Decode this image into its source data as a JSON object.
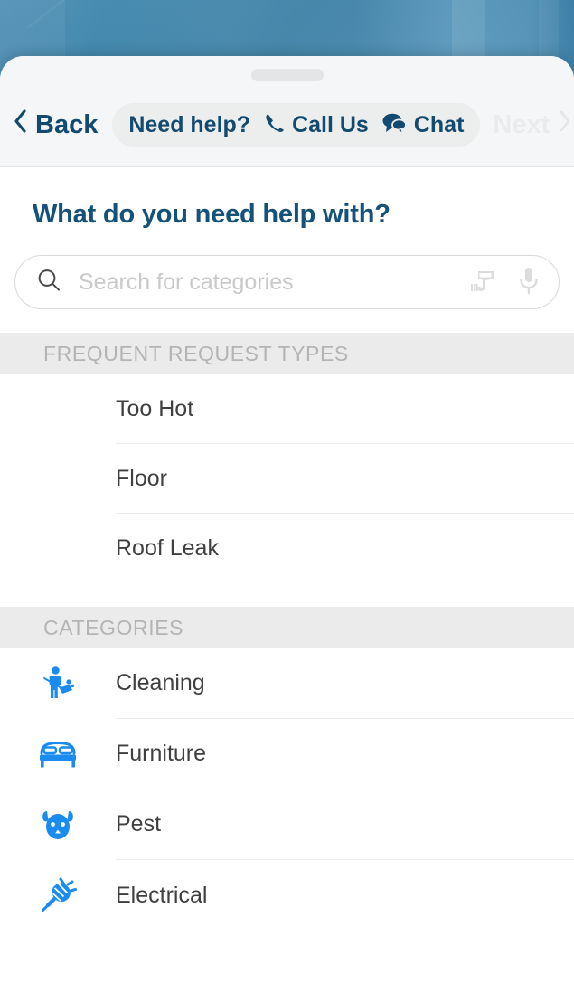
{
  "colors": {
    "brand_navy": "#124a70",
    "heading_navy": "#15527a",
    "icon_blue": "#1a8cf0",
    "section_bg": "#ebebeb",
    "section_text": "#b4b4b4",
    "disabled": "#e9ebec",
    "backdrop_blue": "#4b8fb4"
  },
  "toolbar": {
    "back_label": "Back",
    "back_icon": "chevron-left-icon",
    "next_label": "Next",
    "next_icon": "chevron-right-icon",
    "next_disabled": true,
    "help_pill": {
      "prompt": "Need help?",
      "call_label": "Call Us",
      "call_icon": "phone-icon",
      "chat_label": "Chat",
      "chat_icon": "chat-bubbles-icon"
    }
  },
  "page": {
    "title": "What do you need help with?"
  },
  "search": {
    "placeholder": "Search for categories",
    "value": "",
    "leading_icon": "search-icon",
    "trailing_icons": [
      "barcode-scanner-icon",
      "microphone-icon"
    ]
  },
  "sections": [
    {
      "id": "frequent-request-types",
      "header": "FREQUENT REQUEST TYPES",
      "items": [
        {
          "label": "Too Hot",
          "icon": null
        },
        {
          "label": "Floor",
          "icon": null
        },
        {
          "label": "Roof Leak",
          "icon": null
        }
      ]
    },
    {
      "id": "categories",
      "header": "CATEGORIES",
      "items": [
        {
          "label": "Cleaning",
          "icon": "cleaning-icon"
        },
        {
          "label": "Furniture",
          "icon": "bed-icon"
        },
        {
          "label": "Pest",
          "icon": "mouse-icon"
        },
        {
          "label": "Electrical",
          "icon": "plug-icon"
        }
      ]
    }
  ]
}
